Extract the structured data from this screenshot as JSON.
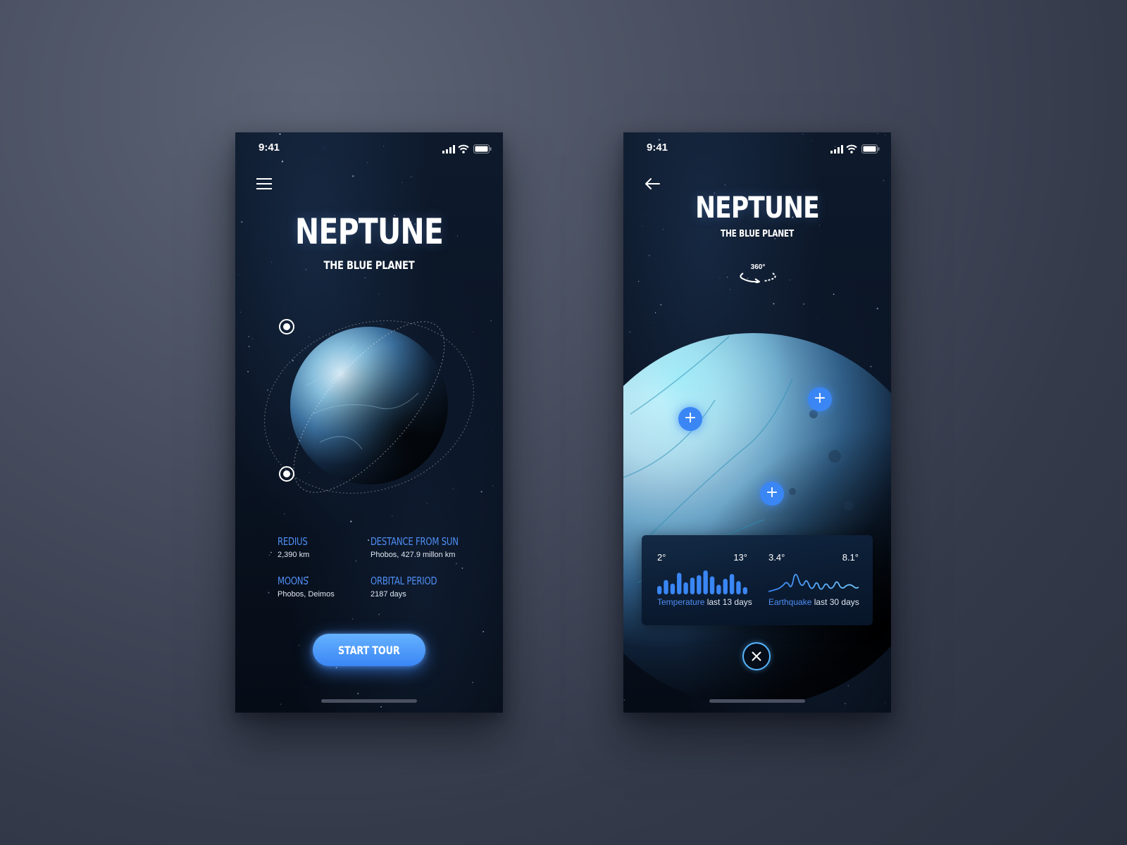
{
  "left_screen": {
    "status": {
      "time": "9:41"
    },
    "title": "NEPTUNE",
    "subtitle": "THE BLUE PLANET",
    "stats": [
      {
        "label": "REDIUS",
        "value": "2,390 km"
      },
      {
        "label": "DESTANCE FROM SUN",
        "value": "Phobos, 427.9 millon km"
      },
      {
        "label": "MOONS",
        "value": "Phobos, Deimos"
      },
      {
        "label": "ORBITAL PERIOD",
        "value": "2187 days"
      }
    ],
    "cta_label": "START TOUR"
  },
  "right_screen": {
    "status": {
      "time": "9:41"
    },
    "title": "NEPTUNE",
    "subtitle": "THE BLUE PLANET",
    "rotate_label": "360°",
    "temperature": {
      "min": "2°",
      "max": "13°",
      "caption_highlight": "Temperature",
      "caption_rest": "last 13 days",
      "bars": [
        0.35,
        0.6,
        0.45,
        0.9,
        0.5,
        0.7,
        0.8,
        1.0,
        0.75,
        0.4,
        0.65,
        0.85,
        0.55,
        0.3
      ]
    },
    "earthquake": {
      "min": "3.4°",
      "max": "8.1°",
      "caption_highlight": "Earthquake",
      "caption_rest": "last 30 days"
    }
  },
  "colors": {
    "accent": "#3a86f5",
    "label_blue": "#4f8ef5",
    "glow_cyan": "#56b6ff"
  },
  "icons": [
    "signal-icon",
    "wifi-icon",
    "battery-icon",
    "menu-icon",
    "back-arrow-icon",
    "rotate-360-icon",
    "plus-icon",
    "close-icon"
  ]
}
